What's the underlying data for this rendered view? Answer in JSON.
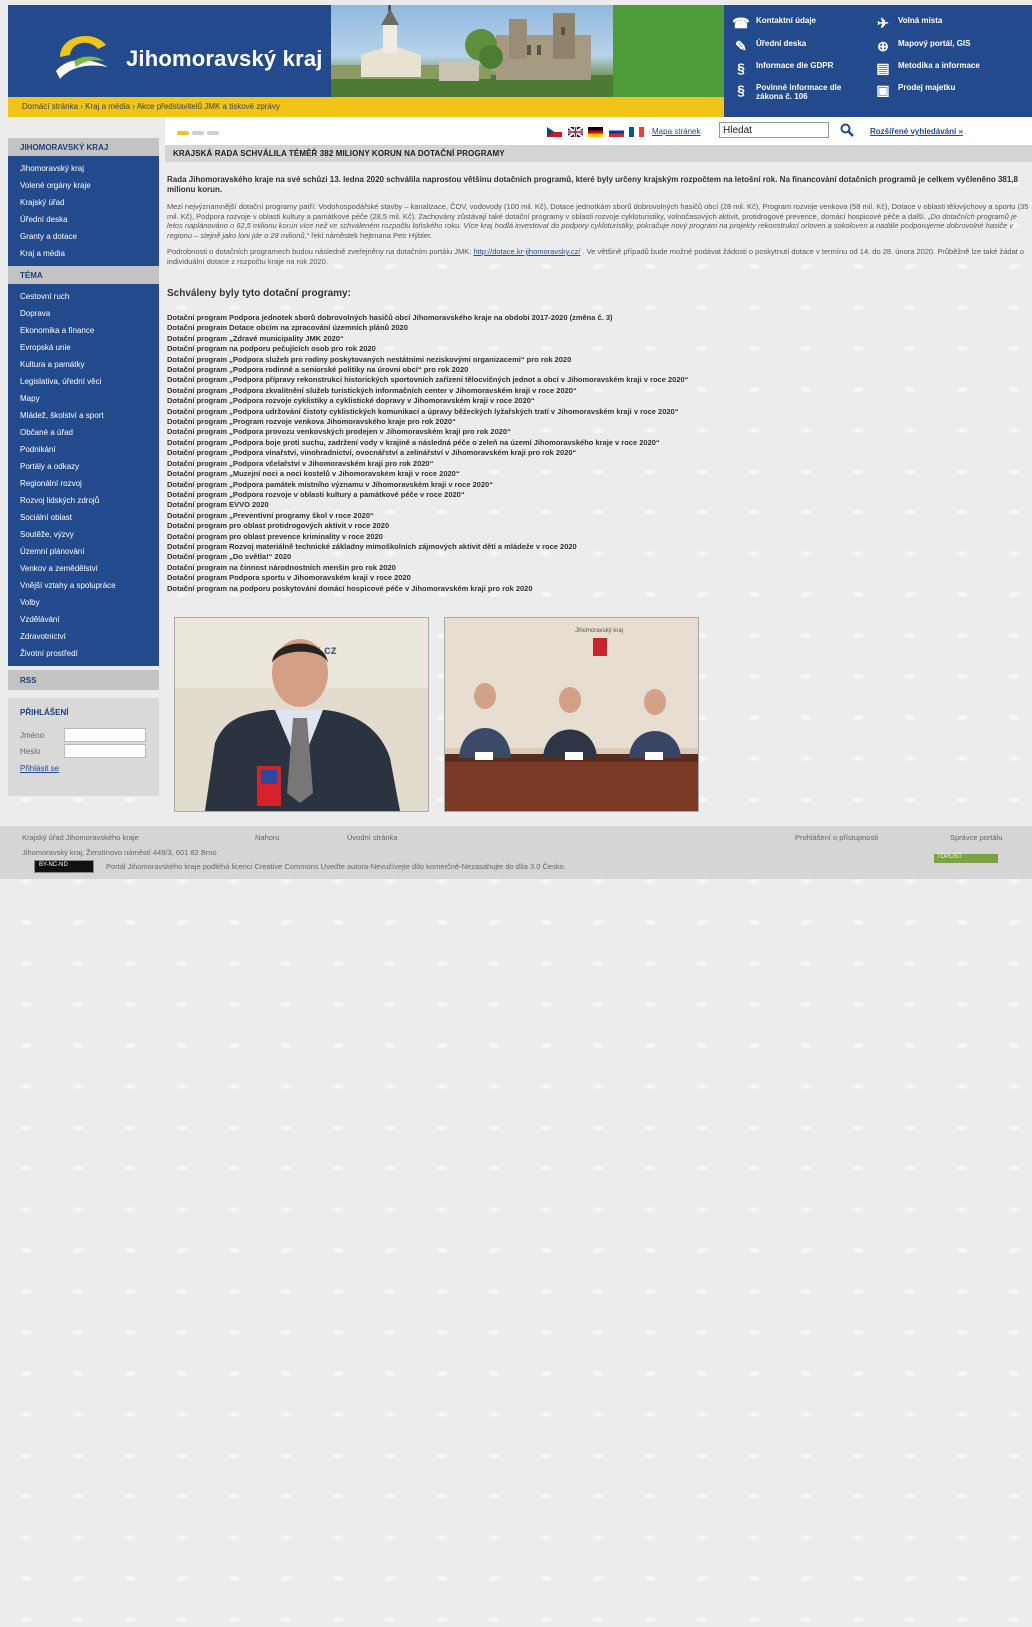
{
  "header": {
    "logo_text": "Jihomoravský kraj",
    "breadcrumb": "Domácí stránka › Kraj a média › Akce představitelů JMK a tiskové zprávy",
    "quicklinks": [
      {
        "label": "Kontaktní údaje",
        "icon": "contacts-icon"
      },
      {
        "label": "Volná místa",
        "icon": "job-icon"
      },
      {
        "label": "Úřední deska",
        "icon": "pin-icon"
      },
      {
        "label": "Mapový portál, GIS",
        "icon": "globe-icon"
      },
      {
        "label": "Informace dle GDPR",
        "icon": "paragraph-icon"
      },
      {
        "label": "Metodika a informace",
        "icon": "document-icon"
      },
      {
        "label": "Povinné informace dle zákona č. 106",
        "icon": "paragraph-icon"
      },
      {
        "label": "Prodej majetku",
        "icon": "sale-icon"
      }
    ]
  },
  "subbar": {
    "sitemap": "Mapa stránek",
    "search_value": "Hledat",
    "advanced_search": "Rozšířené vyhledávání »",
    "flags": [
      "cz",
      "gb",
      "de",
      "ru",
      "fr"
    ]
  },
  "sidebar": {
    "section1_title": "JIHOMORAVSKÝ KRAJ",
    "section1_items": [
      "Jihomoravský kraj",
      "Volené orgány kraje",
      "Krajský úřad",
      "Úřední deska",
      "Granty a dotace",
      "Kraj a média"
    ],
    "section2_title": "TÉMA",
    "section2_items": [
      "Cestovní ruch",
      "Doprava",
      "Ekonomika a finance",
      "Evropská unie",
      "Kultura a památky",
      "Legislativa, úřední věci",
      "Mapy",
      "Mládež, školství a sport",
      "Občané a úřad",
      "Podnikání",
      "Portály a odkazy",
      "Regionální rozvoj",
      "Rozvoj lidských zdrojů",
      "Sociální oblast",
      "Soutěže, výzvy",
      "Územní plánování",
      "Venkov a zemědělství",
      "Vnější vztahy a spolupráce",
      "Volby",
      "Vzdělávání",
      "Zdravotnictví",
      "Životní prostředí"
    ],
    "rss": "RSS",
    "login_title": "PŘIHLÁŠENÍ",
    "login_user_label": "Jméno",
    "login_pass_label": "Heslo",
    "login_button": "Přihlásit se"
  },
  "main": {
    "title": "KRAJSKÁ RADA SCHVÁLILA TÉMĚŘ 382 MILIONY KORUN NA DOTAČNÍ PROGRAMY",
    "lead": "Rada Jihomoravského kraje na své schůzi 13. ledna 2020 schválila naprostou většinu dotačních programů, které byly určeny krajským rozpočtem na letošní rok. Na financování dotačních programů je celkem vyčleněno 381,8 milionu korun.",
    "para1": "Mezi nejvýznamnější dotační programy patří: Vodohospodářské stavby – kanalizace, ČOV, vodovody (100 mil. Kč), Dotace jednotkám sborů dobrovolných hasičů obcí (28 mil. Kč), Program rozvoje venkova (58 mil. Kč), Dotace v oblasti tělovýchovy a sportu (35 mil. Kč), Podpora rozvoje v oblasti kultury a památkové péče (28,5 mil. Kč). Zachovány zůstávají také dotační programy v oblasti rozvoje cykloturistiky, volnočasových aktivit, protidrogové prevence, domácí hospicové péče a další.",
    "para1_quote": "„Do dotačních programů je letos naplánováno o 62,5 milionu korun více než ve schváleném rozpočtu loňského roku. Více kraj hodlá investovat do podpory cykloturistiky, pokračuje nový program na projekty rekonstrukcí orloven a sokoloven a nadále podporujeme dobrovolné hasiče v regionu – stejně jako loni jde o 28 milionů,“",
    "para1_end": "řekl náměstek hejtmana Petr Hýbler.",
    "para2_start": "Podrobnosti o dotačních programech budou následně zveřejněny na dotačním portálu JMK:",
    "para2_link": "http://dotace.kr-jihomoravsky.cz/",
    "para2_end": ". Ve většině případů bude možné podávat žádosti o poskytnutí dotace v termínu od 14. do 28. února 2020. Průběžně lze také žádat o individuální dotace z rozpočtu kraje na rok 2020.",
    "subheading": "Schváleny byly tyto dotační programy:",
    "programs": [
      "Dotační program Podpora jednotek sborů dobrovolných hasičů obcí Jihomoravského kraje na období 2017-2020 (změna č. 3)",
      "Dotační program Dotace obcím na zpracování územních plánů 2020",
      "Dotační program „Zdravé municipality JMK 2020“",
      "Dotační program na podporu pečujících osob pro rok 2020",
      "Dotační program „Podpora služeb pro rodiny poskytovaných nestátními neziskovými organizacemi“ pro rok 2020",
      "Dotační program „Podpora rodinné a seniorské politiky na úrovni obcí“ pro rok 2020",
      "Dotační program „Podpora přípravy rekonstrukcí historických sportovních zařízení tělocvičných jednot a obcí v Jihomoravském kraji v roce 2020“",
      "Dotační program „Podpora zkvalitnění služeb turistických informačních center v Jihomoravském kraji v roce 2020“",
      "Dotační program „Podpora rozvoje cyklistiky a cyklistické dopravy v Jihomoravském kraji v roce 2020“",
      "Dotační program „Podpora udržování čistoty cyklistických komunikací a úpravy běžeckých lyžařských tratí v Jihomoravském kraji v roce 2020“",
      "Dotační program „Program rozvoje venkova Jihomoravského kraje pro rok 2020“",
      "Dotační program „Podpora provozu venkovských prodejen v Jihomoravském kraji pro rok 2020“",
      "Dotační program „Podpora boje proti suchu, zadržení vody v krajině a následná péče o zeleň na území Jihomoravského kraje v roce 2020“",
      "Dotační program „Podpora vinařství, vinohradnictví, ovocnářství a zelinářství v Jihomoravském kraji pro rok 2020“",
      "Dotační program „Podpora včelařství v Jihomoravském kraji pro rok 2020“",
      "Dotační program „Muzejní noci a noci kostelů v Jihomoravském kraji v roce 2020“",
      "Dotační program „Podpora památek místního významu v Jihomoravském kraji v roce 2020“",
      "Dotační program „Podpora rozvoje v oblasti kultury a památkové péče v roce 2020“",
      "Dotační program EVVO 2020",
      "Dotační program „Preventivní programy škol v roce 2020“",
      "Dotační program pro oblast protidrogových aktivit v roce 2020",
      "Dotační program pro oblast prevence kriminality v roce 2020",
      "Dotační program Rozvoj materiálně technické základny mimoškolních zájmových aktivit dětí a mládeže v roce 2020",
      "Dotační program „Do světla!“ 2020",
      "Dotační program na činnost národnostních menšin pro rok 2020",
      "Dotační program Podpora sportu v Jihomoravském kraji v roce 2020",
      "Dotační program na podporu poskytování domácí hospicové péče v Jihomoravském kraji pro rok 2020"
    ],
    "photo1_text": "jmk.cz",
    "photo2_text": "Jihomoravský kraj"
  },
  "footer": {
    "org": "Krajský úřad Jihomoravského kraje",
    "address": "Jihomoravský kraj, Žerotínovo náměstí 449/3, 601 82 Brno",
    "top": "Nahoru",
    "home": "Úvodní stránka",
    "accessibility": "Prohlášení o přístupnosti",
    "admin": "Správce portálu",
    "license_text": "Portál Jihomoravského kraje podléhá licenci   Creative Commons Uveďte autora-Nevužívejte dílo komerčně-Nezasahujte do díla 3.0 Česko.",
    "cc_badge": "BY-NC-ND",
    "toplist": "TOPLIST"
  },
  "colors": {
    "brand_blue": "#244a8e",
    "brand_yellow": "#f0c419",
    "link": "#1f4aa0"
  }
}
